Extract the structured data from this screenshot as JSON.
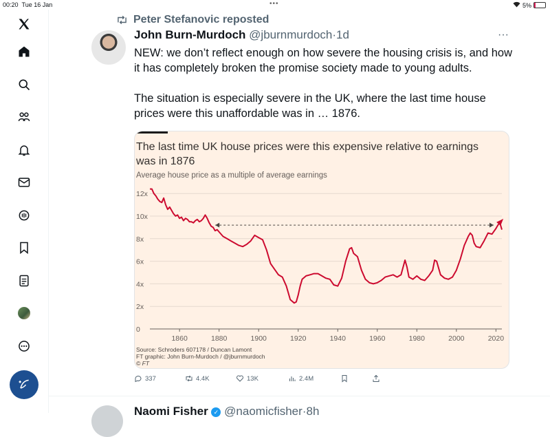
{
  "status_bar": {
    "time": "00:20",
    "date": "Tue 16 Jan",
    "battery": "5%"
  },
  "sidebar": {
    "items": [
      {
        "icon": "x-logo-icon"
      },
      {
        "icon": "home-icon"
      },
      {
        "icon": "search-icon"
      },
      {
        "icon": "communities-icon"
      },
      {
        "icon": "notifications-icon"
      },
      {
        "icon": "messages-icon"
      },
      {
        "icon": "grok-icon"
      },
      {
        "icon": "bookmarks-icon"
      },
      {
        "icon": "lists-icon"
      },
      {
        "icon": "profile-avatar"
      },
      {
        "icon": "more-icon"
      }
    ],
    "compose_icon": "compose-icon"
  },
  "tweet": {
    "repost_text": "Peter Stefanovic reposted",
    "author_name": "John Burn-Murdoch",
    "author_handle": "@jburnmurdoch",
    "time": "1d",
    "text": "NEW: we don’t reflect enough on how severe the housing crisis is, and how it has completely broken the promise society made to young adults.\n\nThe situation is especially severe in the UK, where the last time house prices were this unaffordable was in … 1876.",
    "stats": {
      "replies": "337",
      "reposts": "4.4K",
      "likes": "13K",
      "views": "2.4M"
    }
  },
  "chart_data": {
    "type": "line",
    "title": "The last time UK house prices were this expensive relative to earnings was in 1876",
    "subtitle": "Average house price as a multiple of average earnings",
    "source": "Source: Schroders 607178 / Duncan Lamont",
    "credit": "FT graphic: John Burn-Murdoch / @jburnmurdoch",
    "copyright": "© FT",
    "xlim": [
      1845,
      2023
    ],
    "ylim": [
      0,
      12.5
    ],
    "x_ticks": [
      "1860",
      "1880",
      "1900",
      "1920",
      "1940",
      "1960",
      "1980",
      "2000",
      "2020"
    ],
    "y_ticks": [
      "0",
      "2x",
      "4x",
      "6x",
      "8x",
      "10x",
      "12x"
    ],
    "grid": true,
    "line_color": "#cc0a2f",
    "reference_line": {
      "from": 1876,
      "to": 2023,
      "value": 9.2
    },
    "series": [
      {
        "x": [
          1845,
          1846,
          1847,
          1848,
          1849,
          1850,
          1851,
          1852,
          1853,
          1854,
          1855,
          1856,
          1857,
          1858,
          1859,
          1860,
          1861,
          1862,
          1863,
          1864,
          1865,
          1866,
          1867,
          1868,
          1869,
          1870,
          1871,
          1872,
          1873,
          1874,
          1875,
          1876,
          1877,
          1878,
          1879,
          1880,
          1882,
          1884,
          1886,
          1888,
          1890,
          1892,
          1894,
          1896,
          1898,
          1900,
          1902,
          1904,
          1906,
          1908,
          1910,
          1912,
          1914,
          1916,
          1918,
          1919,
          1920,
          1921,
          1922,
          1924,
          1926,
          1928,
          1930,
          1932,
          1934,
          1936,
          1938,
          1940,
          1942,
          1944,
          1946,
          1947,
          1948,
          1950,
          1952,
          1954,
          1956,
          1958,
          1960,
          1962,
          1964,
          1966,
          1968,
          1970,
          1972,
          1974,
          1975,
          1976,
          1978,
          1980,
          1982,
          1984,
          1986,
          1988,
          1989,
          1990,
          1992,
          1994,
          1996,
          1998,
          2000,
          2002,
          2004,
          2006,
          2007,
          2008,
          2009,
          2010,
          2012,
          2014,
          2016,
          2018,
          2020,
          2021,
          2022,
          2023
        ],
        "y": [
          12.4,
          12.4,
          12.0,
          11.8,
          11.5,
          11.3,
          11.2,
          11.6,
          11.0,
          10.6,
          10.8,
          10.5,
          10.2,
          10.0,
          10.1,
          9.8,
          9.9,
          9.6,
          9.8,
          9.7,
          9.5,
          9.5,
          9.4,
          9.6,
          9.7,
          9.5,
          9.6,
          9.8,
          10.1,
          9.8,
          9.4,
          9.1,
          9.0,
          8.7,
          8.8,
          8.6,
          8.2,
          8.0,
          7.8,
          7.6,
          7.4,
          7.3,
          7.5,
          7.8,
          8.3,
          8.1,
          7.9,
          7.0,
          5.8,
          5.3,
          4.8,
          4.6,
          3.8,
          2.6,
          2.3,
          2.4,
          3.0,
          3.8,
          4.4,
          4.7,
          4.8,
          4.9,
          4.9,
          4.7,
          4.5,
          4.4,
          3.9,
          3.8,
          4.5,
          6.0,
          7.1,
          7.2,
          6.7,
          6.4,
          5.2,
          4.4,
          4.1,
          4.0,
          4.1,
          4.3,
          4.6,
          4.7,
          4.8,
          4.6,
          4.8,
          6.1,
          5.5,
          4.6,
          4.4,
          4.7,
          4.4,
          4.3,
          4.7,
          5.2,
          6.1,
          6.0,
          4.8,
          4.5,
          4.4,
          4.6,
          5.2,
          6.2,
          7.4,
          8.2,
          8.5,
          8.3,
          7.6,
          7.3,
          7.2,
          7.8,
          8.5,
          8.4,
          8.9,
          9.2,
          9.4,
          8.8
        ]
      }
    ]
  },
  "next_tweet": {
    "author_name": "Naomi Fisher",
    "author_handle": "@naomicfisher",
    "time": "8h"
  }
}
